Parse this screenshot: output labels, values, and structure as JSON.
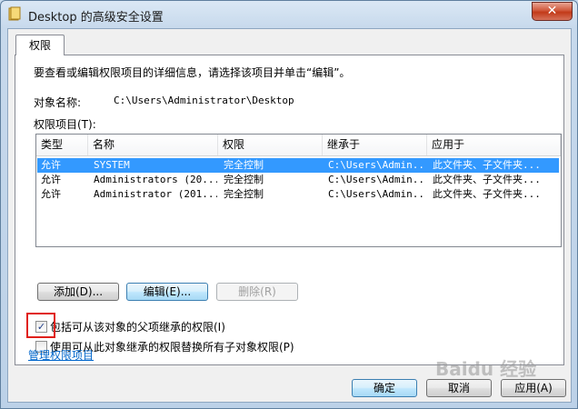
{
  "window": {
    "title": "Desktop 的高级安全设置",
    "close_glyph": "✕"
  },
  "tabs": [
    {
      "label": "权限"
    }
  ],
  "intro_text": "要查看或编辑权限项目的详细信息，请选择该项目并单击“编辑”。",
  "object_name": {
    "label": "对象名称:",
    "value": "C:\\Users\\Administrator\\Desktop"
  },
  "entries_label": "权限项目(T):",
  "table": {
    "columns": [
      "类型",
      "名称",
      "权限",
      "继承于",
      "应用于"
    ],
    "rows": [
      {
        "type": "允许",
        "name": "SYSTEM",
        "permission": "完全控制",
        "inherited": "C:\\Users\\Admin...",
        "applies": "此文件夹、子文件夹...",
        "selected": true
      },
      {
        "type": "允许",
        "name": "Administrators (20...",
        "permission": "完全控制",
        "inherited": "C:\\Users\\Admin...",
        "applies": "此文件夹、子文件夹...",
        "selected": false
      },
      {
        "type": "允许",
        "name": "Administrator (201...",
        "permission": "完全控制",
        "inherited": "C:\\Users\\Admin...",
        "applies": "此文件夹、子文件夹...",
        "selected": false
      }
    ]
  },
  "buttons": {
    "add": "添加(D)...",
    "edit": "编辑(E)...",
    "remove": "删除(R)"
  },
  "checkboxes": {
    "include_inheritable": {
      "label": "包括可从该对象的父项继承的权限(I)",
      "checked": true
    },
    "replace_child": {
      "label": "使用可从此对象继承的权限替换所有子对象权限(P)",
      "checked": false
    }
  },
  "manage_link": "管理权限项目",
  "footer": {
    "ok": "确定",
    "cancel": "取消",
    "apply": "应用(A)"
  },
  "watermark": "Baidu 经验",
  "colors": {
    "selection": "#3399ff",
    "highlight_box": "#e0201a",
    "link": "#0066cc"
  }
}
